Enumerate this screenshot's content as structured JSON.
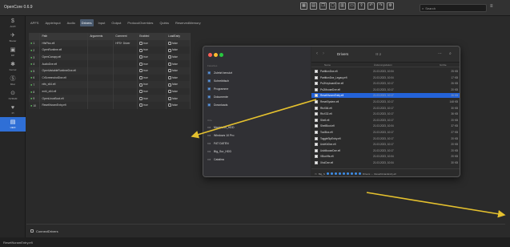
{
  "app": {
    "title": "OpenCore 0.6.9"
  },
  "toolbar": {
    "icons": [
      "grid-icon",
      "save-icon",
      "copy-icon",
      "window-icon",
      "document-icon",
      "folder-icon",
      "share-icon",
      "undo-icon",
      "redo-icon",
      "settings-icon"
    ],
    "search_placeholder": "Search",
    "right_symbol": "≡"
  },
  "sidebar": {
    "items": [
      {
        "label": "ACPI",
        "icon": "$"
      },
      {
        "label": "Booter",
        "icon": "✈"
      },
      {
        "label": "DP",
        "icon": "▣"
      },
      {
        "label": "Kernel",
        "icon": "✱"
      },
      {
        "label": "Misc",
        "icon": "Ⓢ"
      },
      {
        "label": "NVRAM",
        "icon": "⊙"
      },
      {
        "label": "PI",
        "icon": "♥"
      },
      {
        "label": "UEFI",
        "icon": "▤"
      }
    ]
  },
  "tabs": [
    {
      "label": "APFS"
    },
    {
      "label": "AppleInput"
    },
    {
      "label": "Audio"
    },
    {
      "label": "Drivers"
    },
    {
      "label": "Input"
    },
    {
      "label": "Output"
    },
    {
      "label": "ProtocolOverrides"
    },
    {
      "label": "Quirks"
    },
    {
      "label": "ReservedMemory"
    }
  ],
  "table": {
    "headers": [
      "",
      "Path",
      "Arguments",
      "Comment",
      "Enabled",
      "LoadEarly"
    ],
    "rows": [
      {
        "num": "1",
        "path": "HfsPlus.efi",
        "args": "",
        "comment": "HFS+ Driver",
        "enabled": "true",
        "early": "false"
      },
      {
        "num": "2",
        "path": "OpenRuntime.efi",
        "args": "",
        "comment": "",
        "enabled": "true",
        "early": "false"
      },
      {
        "num": "3",
        "path": "OpenCanopy.efi",
        "args": "",
        "comment": "",
        "enabled": "true",
        "early": "false"
      },
      {
        "num": "4",
        "path": "AudioDxe.efi",
        "args": "",
        "comment": "",
        "enabled": "true",
        "early": "false"
      },
      {
        "num": "5",
        "path": "OpenVariableRuntimeDxe.efi",
        "args": "",
        "comment": "",
        "enabled": "true",
        "early": "false"
      },
      {
        "num": "6",
        "path": "CrScreenshotDxe.efi",
        "args": "",
        "comment": "",
        "enabled": "true",
        "early": "false"
      },
      {
        "num": "7",
        "path": "ntfs_x64.efi",
        "args": "",
        "comment": "",
        "enabled": "true",
        "early": "false"
      },
      {
        "num": "8",
        "path": "ext4_x64.efi",
        "args": "",
        "comment": "",
        "enabled": "true",
        "early": "false"
      },
      {
        "num": "9",
        "path": "OpenLinuxBoot.efi",
        "args": "",
        "comment": "",
        "enabled": "true",
        "early": "false"
      },
      {
        "num": "10",
        "path": "ResetNvramEntry.efi",
        "args": "",
        "comment": "",
        "enabled": "true",
        "early": "false"
      }
    ]
  },
  "bottom": {
    "label": "ConnectDrivers"
  },
  "status": {
    "text": "ResetNvramEntry.efi"
  },
  "finder": {
    "title": "Drivers",
    "view_count": "☷ 2",
    "sidebar": {
      "favorites_header": "Favorites",
      "favorites": [
        "Zuletzt benutzt",
        "Schreibtisch",
        "Programme",
        "Dokumente",
        "Downloads"
      ],
      "locations_header": "Orte",
      "locations": [
        "Macintosh_HDD",
        "Windows 10 Pro",
        "FAT DATEN",
        "Big_Sur_HDD",
        "Catalina"
      ]
    },
    "columns": {
      "name": "Name",
      "date": "Änderungsdatum",
      "size": "Größe"
    },
    "files": [
      {
        "name": "PartitionDxe.efi",
        "date": "21.03.2023, 10:04",
        "size": "25 KB"
      },
      {
        "name": "PartitionDxe_Legacy.efi",
        "date": "21.03.2023, 10:04",
        "size": "17 KB"
      },
      {
        "name": "Ps2KeyboardDxe.efi",
        "date": "21.03.2023, 10:17",
        "size": "26 KB"
      },
      {
        "name": "Ps2MouseDxe.efi",
        "date": "21.03.2023, 10:17",
        "size": "20 KB"
      },
      {
        "name": "ResetNvramEntry.efi",
        "date": "21.03.2023, 10:17",
        "size": "26 KB",
        "selected": true
      },
      {
        "name": "ResetSystem.efi",
        "date": "21.03.2023, 10:17",
        "size": "148 KB"
      },
      {
        "name": "RtcX64.efi",
        "date": "21.03.2023, 10:17",
        "size": "30 KB"
      },
      {
        "name": "RtcX32.efi",
        "date": "21.03.2023, 10:17",
        "size": "36 KB"
      },
      {
        "name": "Shell.efi",
        "date": "21.03.2023, 10:17",
        "size": "20 KB"
      },
      {
        "name": "ShellBoot.efi",
        "date": "21.03.2023, 10:04",
        "size": "37 KB"
      },
      {
        "name": "ToolBox.efi",
        "date": "21.03.2023, 10:17",
        "size": "27 KB"
      },
      {
        "name": "ToggleSipEntry.efi",
        "date": "21.03.2023, 10:17",
        "size": "20 KB"
      },
      {
        "name": "UsbKbDxe.efi",
        "date": "21.03.2023, 10:17",
        "size": "20 KB"
      },
      {
        "name": "UsbMouseDxe.efi",
        "date": "21.03.2023, 10:17",
        "size": "20 KB"
      },
      {
        "name": "VBoxHfs.efi",
        "date": "21.03.2023, 10:04",
        "size": "20 KB"
      },
      {
        "name": "XhciDxe.efi",
        "date": "21.03.2023, 10:04",
        "size": "30 KB"
      }
    ],
    "path_start": "Big_S",
    "path_drivers": "Drivers",
    "path_file": "ResetNvramEntry.efi"
  },
  "colors": {
    "accent": "#2f6fd6",
    "selection": "#2463d8",
    "arrow": "#e5c12e",
    "enabled": "#5fc160"
  }
}
